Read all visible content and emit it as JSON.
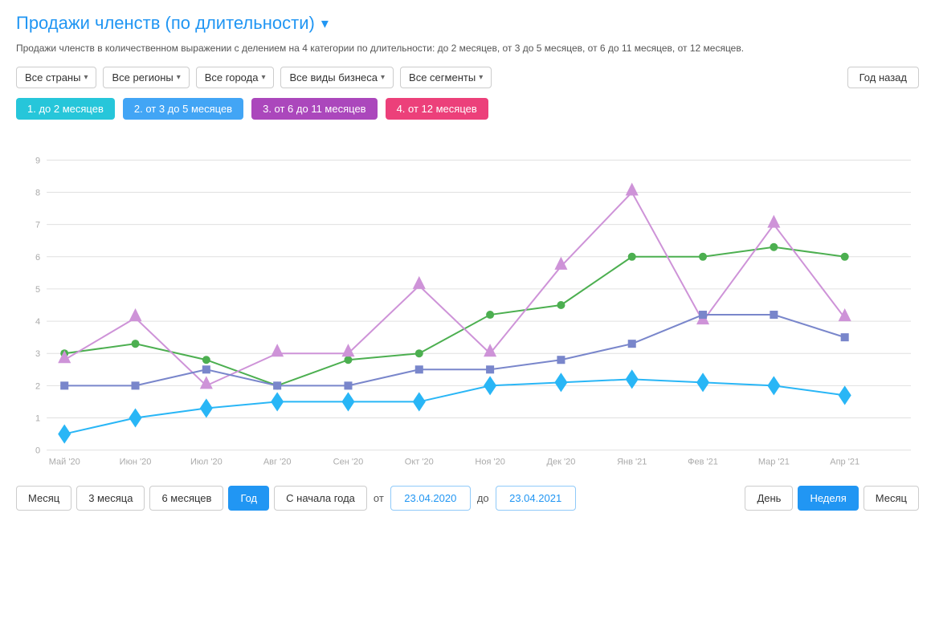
{
  "title": "Продажи членств (по длительности)",
  "subtitle": "Продажи членств в количественном выражении с делением на 4 категории по длительности: до 2 месяцев, от 3 до 5 месяцев, от 6 до 11 месяцев, от 12 месяцев.",
  "filters": {
    "countries": "Все страны",
    "regions": "Все регионы",
    "cities": "Все города",
    "business": "Все виды бизнеса",
    "segments": "Все сегменты",
    "period_btn": "Год назад"
  },
  "legend": [
    {
      "id": "1",
      "label": "1. до 2 месяцев",
      "color": "#26C6DA"
    },
    {
      "id": "2",
      "label": "2. от 3 до 5 месяцев",
      "color": "#42A5F5"
    },
    {
      "id": "3",
      "label": "3. от 6 до 11 месяцев",
      "color": "#AB47BC"
    },
    {
      "id": "4",
      "label": "4. от 12 месяцев",
      "color": "#EC407A"
    }
  ],
  "xaxis": [
    "Май '20",
    "Июн '20",
    "Июл '20",
    "Авг '20",
    "Сен '20",
    "Окт '20",
    "Ноя '20",
    "Дек '20",
    "Янв '21",
    "Фев '21",
    "Мар '21",
    "Апр '21"
  ],
  "yaxis": [
    0,
    1,
    2,
    3,
    4,
    5,
    6,
    7,
    8,
    9
  ],
  "bottom": {
    "month": "Месяц",
    "three_months": "3 месяца",
    "six_months": "6 месяцев",
    "year": "Год",
    "ytd": "С начала года",
    "from_label": "от",
    "to_label": "до",
    "from_date": "23.04.2020",
    "to_date": "23.04.2021",
    "day": "День",
    "week": "Неделя",
    "month2": "Месяц"
  }
}
